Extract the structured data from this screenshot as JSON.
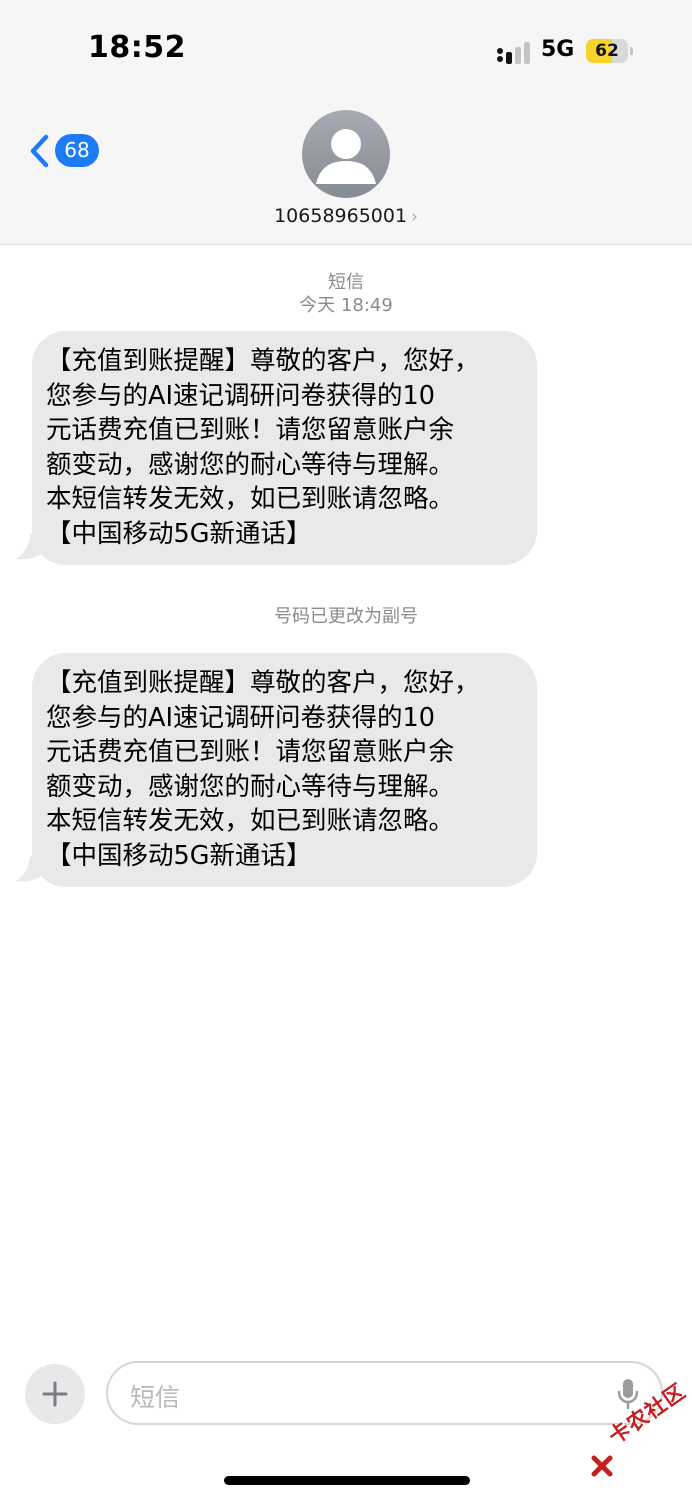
{
  "status_bar": {
    "time": "18:52",
    "network": "5G",
    "battery": "62",
    "battery_level": 0.62
  },
  "nav": {
    "back_count": "68",
    "contact": "10658965001",
    "contact_chevron": "›"
  },
  "thread": {
    "service_label": "短信",
    "timestamp": "今天 18:49",
    "notice": "号码已更改为副号",
    "messages": [
      {
        "lines": [
          "【充值到账提醒】尊敬的客户，您好，",
          "您参与的AI速记调研问卷获得的10",
          "元话费充值已到账！请您留意账户余",
          "额变动，感谢您的耐心等待与理解。",
          "本短信转发无效，如已到账请忽略。",
          "【中国移动5G新通话】"
        ]
      },
      {
        "lines": [
          "【充值到账提醒】尊敬的客户，您好，",
          "您参与的AI速记调研问卷获得的10",
          "元话费充值已到账！请您留意账户余",
          "额变动，感谢您的耐心等待与理解。",
          "本短信转发无效，如已到账请忽略。",
          "【中国移动5G新通话】"
        ]
      }
    ]
  },
  "composer": {
    "placeholder": "短信"
  },
  "watermark": {
    "text": "卡农社区"
  },
  "colors": {
    "accent": "#1b7cf6",
    "bubble": "#e9e9eb",
    "header_bg": "#f6f6f6",
    "meta_text": "#8b8b8f",
    "battery_fill": "#f6d22b"
  },
  "icons": [
    "chevron-left-icon",
    "signal-icon",
    "battery-icon",
    "person-icon",
    "plus-icon",
    "microphone-icon"
  ]
}
